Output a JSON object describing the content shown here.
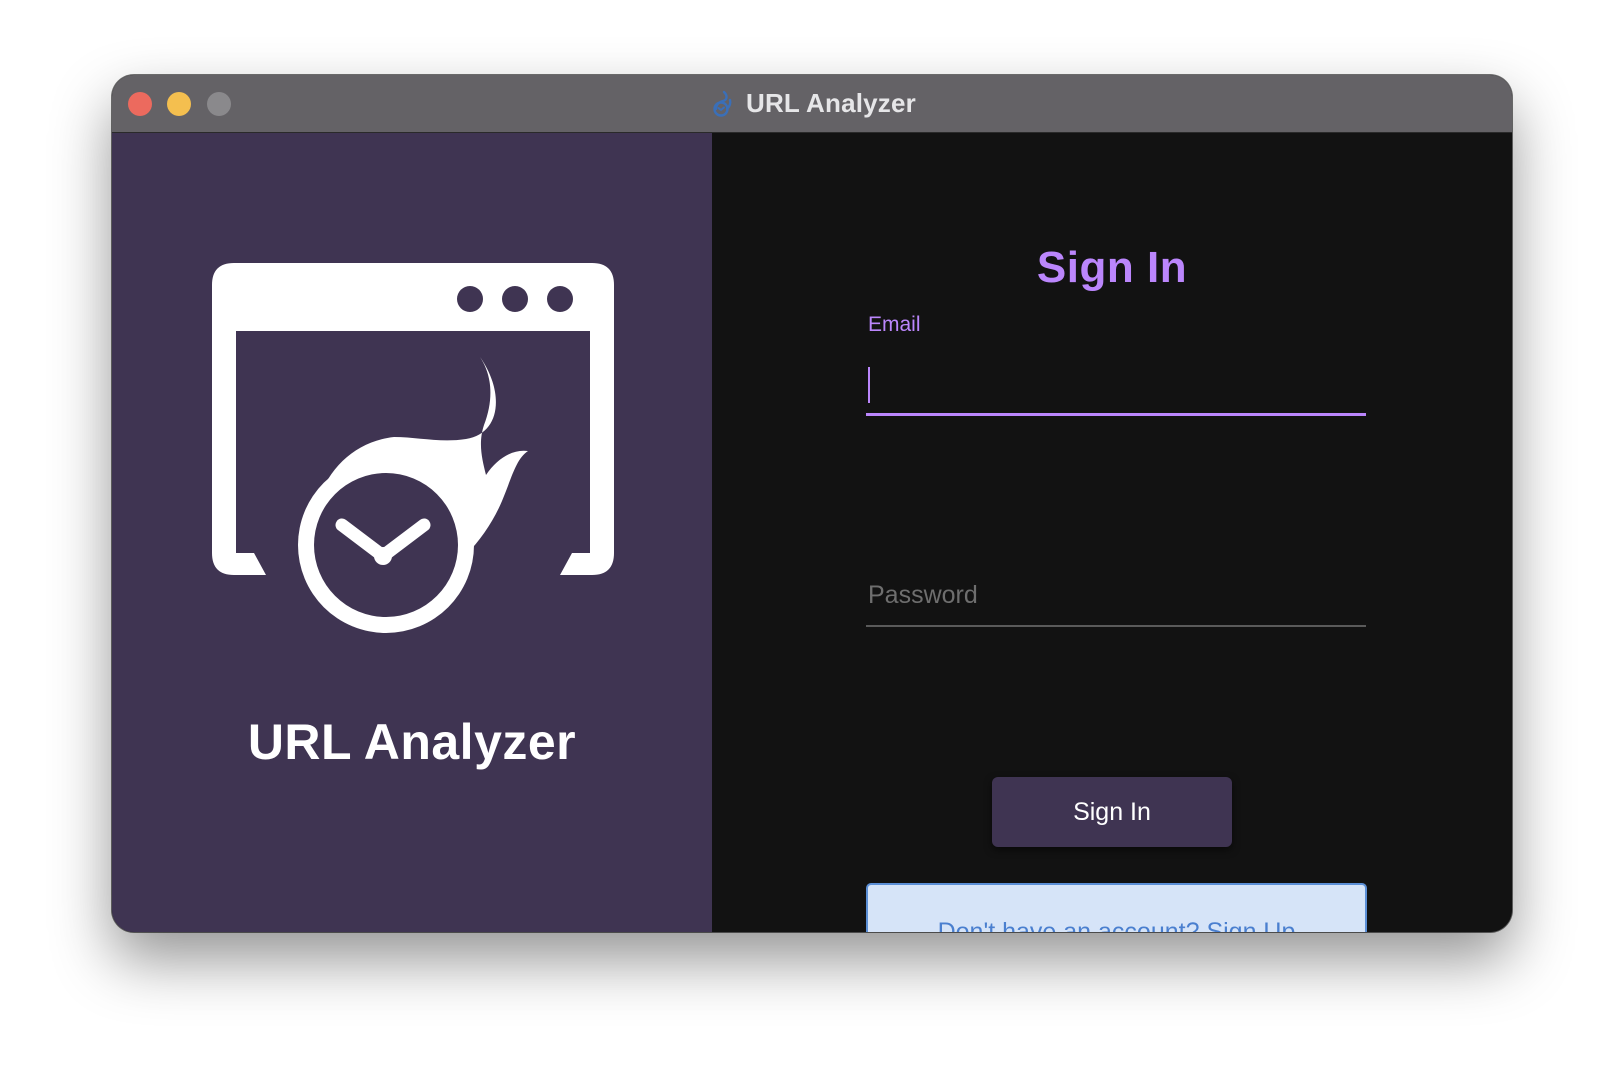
{
  "window": {
    "title": "URL Analyzer",
    "app_icon": "flame-clock-icon"
  },
  "brand": {
    "name": "URL Analyzer",
    "logo_icon": "browser-window-flame-clock-icon"
  },
  "form": {
    "heading": "Sign In",
    "email_label": "Email",
    "email_value": "",
    "password_placeholder": "Password",
    "password_value": "",
    "signin_label": "Sign In",
    "signup_label": "Don't have an account? Sign Up"
  },
  "colors": {
    "accent": "#bb86fc",
    "sidebar_bg": "#3f3452",
    "content_bg": "#121212",
    "link_blue": "#4a7fcf"
  }
}
